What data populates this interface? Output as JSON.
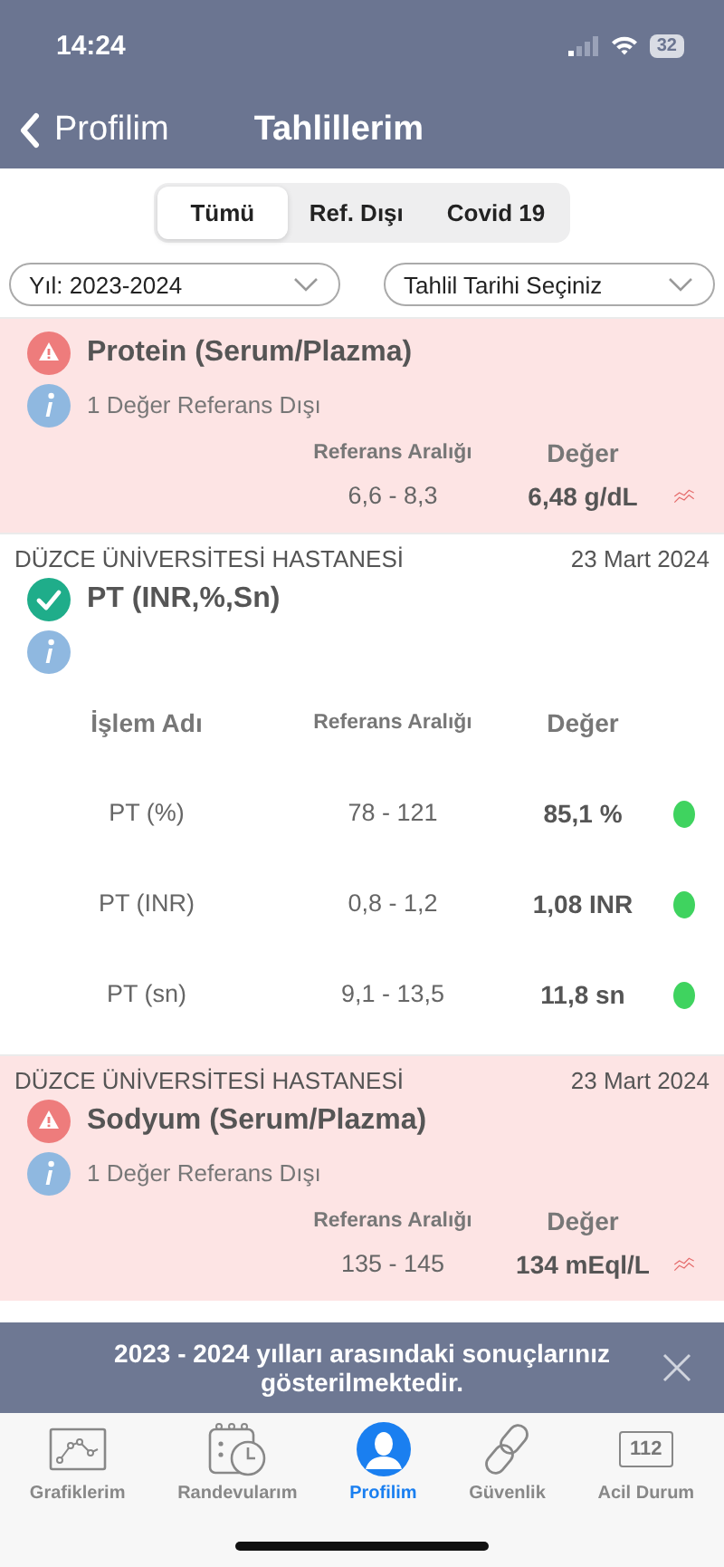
{
  "status_bar": {
    "time": "14:24",
    "battery": "32"
  },
  "nav": {
    "back": "Profilim",
    "title": "Tahlillerim"
  },
  "tabs": [
    {
      "label": "Tümü",
      "selected": true
    },
    {
      "label": "Ref. Dışı",
      "selected": false
    },
    {
      "label": "Covid 19",
      "selected": false
    }
  ],
  "filters": [
    {
      "value": "Yıl: 2023-2024"
    },
    {
      "value": "Tahlil Tarihi Seçiniz"
    }
  ],
  "cards": [
    {
      "out_of_range": true,
      "title": "Protein (Serum/Plazma)",
      "note": "1 Değer Referans Dışı",
      "columns": [
        "Referans Aralığı",
        "Değer"
      ],
      "rows": [
        {
          "range": "6,6 - 8,3",
          "value": "6,48 g/dL",
          "in_range": false
        }
      ]
    },
    {
      "out_of_range": false,
      "hospital": "DÜZCE ÜNİVERSİTESİ HASTANESİ",
      "date": "23 Mart 2024",
      "title": "PT (INR,%,Sn)",
      "name_column": "İşlem Adı",
      "columns": [
        "Referans Aralığı",
        "Değer"
      ],
      "rows": [
        {
          "name": "PT (%)",
          "range": "78 - 121",
          "value": "85,1 %",
          "in_range": true
        },
        {
          "name": "PT (INR)",
          "range": "0,8 - 1,2",
          "value": "1,08 INR",
          "in_range": true
        },
        {
          "name": "PT (sn)",
          "range": "9,1 - 13,5",
          "value": "11,8 sn",
          "in_range": true
        }
      ]
    },
    {
      "out_of_range": true,
      "hospital": "DÜZCE ÜNİVERSİTESİ HASTANESİ",
      "date": "23 Mart 2024",
      "title": "Sodyum (Serum/Plazma)",
      "note": "1 Değer Referans Dışı",
      "columns": [
        "Referans Aralığı",
        "Değer"
      ],
      "rows": [
        {
          "range": "135 - 145",
          "value": "134 mEql/L",
          "in_range": false
        }
      ]
    }
  ],
  "banner": {
    "text": "2023 - 2024 yılları arasındaki sonuçlarınız gösterilmektedir."
  },
  "tab_bar": [
    {
      "kind": "chart",
      "label": "Grafiklerim",
      "selected": false
    },
    {
      "kind": "calendar",
      "label": "Randevularım",
      "selected": false
    },
    {
      "kind": "profile",
      "label": "Profilim",
      "selected": true
    },
    {
      "kind": "link",
      "label": "Güvenlik",
      "selected": false
    },
    {
      "kind": "emergency",
      "label": "Acil Durum",
      "code": "112",
      "selected": false
    }
  ]
}
